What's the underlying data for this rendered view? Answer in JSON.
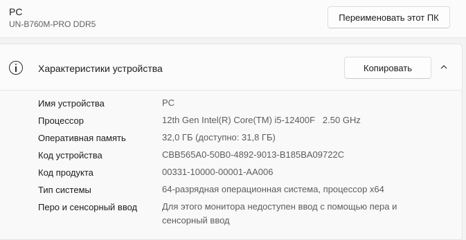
{
  "top": {
    "pc_name": "PC",
    "pc_model": "UN-B760M-PRO DDR5",
    "rename_button": "Переименовать этот ПК"
  },
  "specs": {
    "title": "Характеристики устройства",
    "copy_button": "Копировать",
    "rows": [
      {
        "label": "Имя устройства",
        "value": "PC"
      },
      {
        "label": "Процессор",
        "value": "12th Gen Intel(R) Core(TM) i5-12400F   2.50 GHz"
      },
      {
        "label": "Оперативная память",
        "value": "32,0 ГБ (доступно: 31,8 ГБ)"
      },
      {
        "label": "Код устройства",
        "value": "CBB565A0-50B0-4892-9013-B185BA09722C"
      },
      {
        "label": "Код продукта",
        "value": "00331-10000-00001-AA006"
      },
      {
        "label": "Тип системы",
        "value": "64-разрядная операционная система, процессор x64"
      },
      {
        "label": "Перо и сенсорный ввод",
        "value": "Для этого монитора недоступен ввод с помощью пера и сенсорный ввод"
      }
    ]
  },
  "icons": {
    "info": "info-icon",
    "collapse": "chevron-up-icon"
  }
}
